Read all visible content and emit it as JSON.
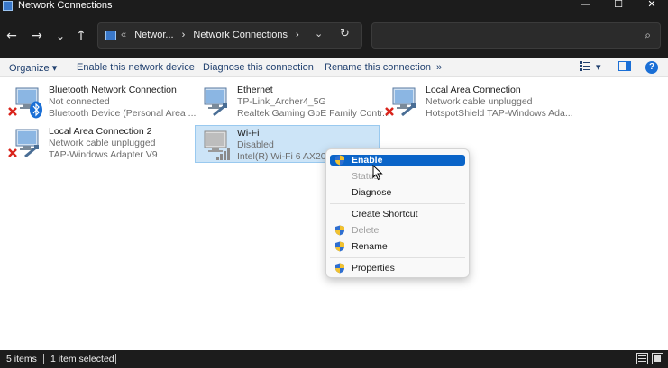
{
  "window": {
    "title": "Network Connections",
    "minimize_glyph": "—",
    "maximize_glyph": "☐",
    "close_glyph": "✕"
  },
  "nav": {
    "back_glyph": "←",
    "forward_glyph": "→",
    "recent_glyph": "⌄",
    "up_glyph": "↑",
    "breadcrumb_prefix": "«",
    "breadcrumbs": [
      "Networ...",
      "›",
      "Network Connections",
      "›"
    ],
    "address_dropdown_glyph": "⌄",
    "refresh_glyph": "↻",
    "search_placeholder": "",
    "search_glyph": "⌕"
  },
  "commands": {
    "organize": "Organize ▾",
    "enable_device": "Enable this network device",
    "diagnose": "Diagnose this connection",
    "rename": "Rename this connection",
    "more": "»",
    "view_glyph": "▾",
    "help": "?"
  },
  "connections": [
    {
      "name": "Bluetooth Network Connection",
      "status": "Not connected",
      "device": "Bluetooth Device (Personal Area ..."
    },
    {
      "name": "Ethernet",
      "status": "TP-Link_Archer4_5G",
      "device": "Realtek Gaming GbE Family Contr..."
    },
    {
      "name": "Local Area Connection",
      "status": "Network cable unplugged",
      "device": "HotspotShield TAP-Windows Ada..."
    },
    {
      "name": "Local Area Connection 2",
      "status": "Network cable unplugged",
      "device": "TAP-Windows Adapter V9"
    },
    {
      "name": "Wi-Fi",
      "status": "Disabled",
      "device": "Intel(R) Wi-Fi 6 AX200"
    }
  ],
  "context_menu": {
    "enable": "Enable",
    "status": "Status",
    "diagnose": "Diagnose",
    "create_shortcut": "Create Shortcut",
    "delete": "Delete",
    "rename": "Rename",
    "properties": "Properties"
  },
  "status_bar": {
    "items_count": "5 items",
    "selected": "1 item selected"
  },
  "colors": {
    "accent": "#0a64c8",
    "selection": "#cce4f7",
    "dark_chrome": "#1c1c1c",
    "error_red": "#d9241c"
  }
}
